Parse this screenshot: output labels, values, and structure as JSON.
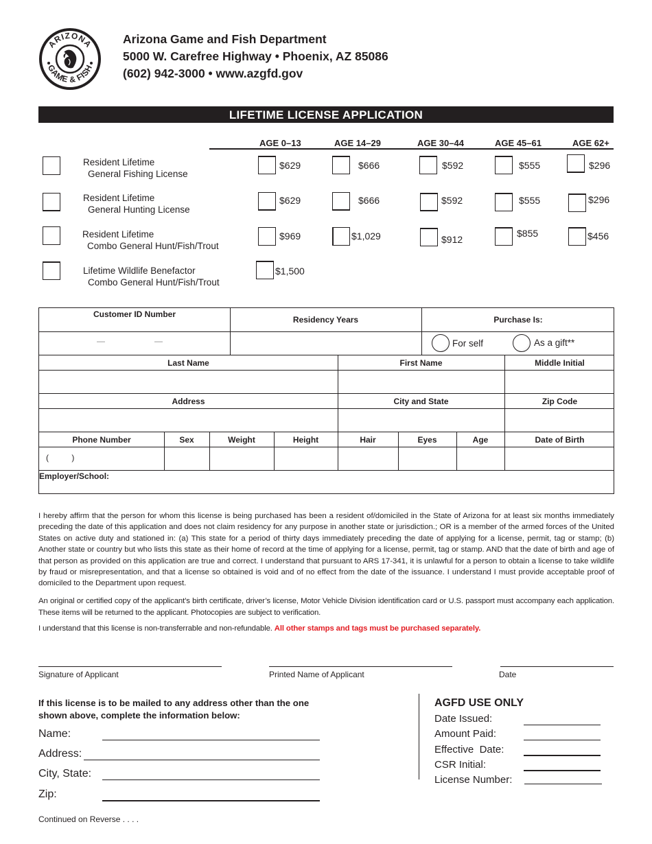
{
  "header": {
    "logo": {
      "icon": "arizona-game-and-fish-seal-icon",
      "top_text": "ARIZONA",
      "bottom_text": "GAME & FISH"
    },
    "org_name": "Arizona Game and Fish Department",
    "address": "5000 W. Carefree Highway • Phoenix, AZ 85086",
    "contact": "(602) 942-3000 • www.azgfd.gov"
  },
  "title": "LIFETIME  LICENSE  APPLICATION",
  "age_columns": [
    "AGE 0–13",
    "AGE 14–29",
    "AGE 30–44",
    "AGE 45–61",
    "AGE 62+"
  ],
  "licenses": [
    {
      "line1": "Resident Lifetime",
      "line2": "General Fishing License",
      "prices": [
        "$629",
        "$666",
        "$592",
        "$555",
        "$296"
      ]
    },
    {
      "line1": "Resident Lifetime",
      "line2": "General Hunting License",
      "prices": [
        "$629",
        "$666",
        "$592",
        "$555",
        "$296"
      ]
    },
    {
      "line1": "Resident Lifetime",
      "line2": "Combo General Hunt/Fish/Trout",
      "prices": [
        "$969",
        "$1,029",
        "$912",
        "$855",
        "$456"
      ]
    },
    {
      "line1": "Lifetime Wildlife Benefactor",
      "line2": "Combo General Hunt/Fish/Trout",
      "prices": [
        "$1,500"
      ]
    }
  ],
  "form": {
    "customer_id": {
      "label": "Customer ID Number",
      "separator": "—"
    },
    "residency_years": {
      "label": "Residency Years"
    },
    "purchase_is": {
      "label": "Purchase Is:",
      "options": [
        "For self",
        "As a gift**"
      ]
    },
    "row2_headers": [
      "Last Name",
      "First Name",
      "Middle Initial"
    ],
    "row3_headers": [
      "Address",
      "City and State",
      "Zip Code"
    ],
    "row4_headers": [
      "Phone Number",
      "Sex",
      "Weight",
      "Height",
      "Hair",
      "Eyes",
      "Age",
      "Date of Birth"
    ],
    "phone_placeholder": "(          )",
    "employer_label": "Employer/School:"
  },
  "legal": {
    "affirmation": "I hereby affirm that the person for whom this license is being purchased has been a resident of/domiciled in the State of Arizona for at least six months immediately preceding the date of this application and does not claim residency for any purpose in another state or jurisdiction.; OR is a member of the armed forces of the United States on active duty and stationed in: (a) This state for a period of thirty days immediately preceding the date of applying for a license, permit, tag or stamp; (b) Another state or country but who lists this state as their home of record at the time of applying for a license, permit, tag or stamp. AND that the date of birth and age of that person as provided on this application are true and correct. I understand that pursuant to ARS 17-341, it is unlawful for a person to obtain a license to take wildlife by fraud or misrepresentation, and that a license so obtained is void and of no effect from the date of the issuance. I understand I must provide acceptable proof of domiciled to the Department upon request.",
    "documents": "An original or certified copy of the applicant’s birth certificate, driver’s license, Motor Vehicle Division identification card or U.S. passport must accompany each application. These items will be returned to the applicant. Photocopies are subject to verification.",
    "non_transferable": "I understand that this license is non-transferrable and non-refundable. ",
    "warning": "All other stamps and tags must be purchased separately.",
    "warning_color": "#e31e24"
  },
  "signatures": {
    "signature_label": "Signature of Applicant",
    "printed_name_label": "Printed Name of Applicant",
    "date_label": "Date"
  },
  "mailing": {
    "intro": "If this license is to be mailed to any address other than the one shown above, complete the information below:",
    "fields": [
      "Name:",
      "Address:",
      "City, State:",
      "Zip:"
    ],
    "continued": "Continued on Reverse . . . ."
  },
  "agfd": {
    "title": "AGFD USE ONLY",
    "fields": [
      "Date Issued:",
      "Amount Paid:",
      "Effective  Date:",
      "CSR Initial:",
      "License Number:"
    ]
  }
}
